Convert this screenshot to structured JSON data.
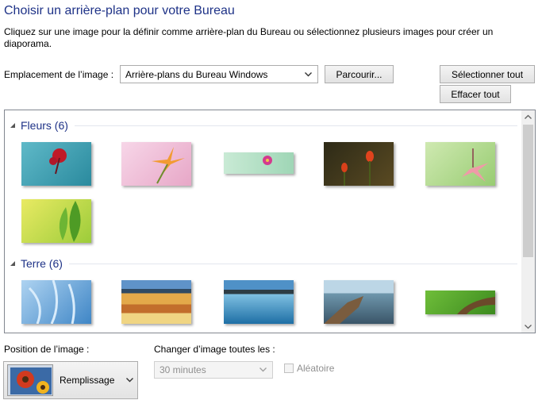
{
  "header": {
    "title": "Choisir un arrière-plan pour votre Bureau",
    "description": "Cliquez sur une image pour la définir comme arrière-plan du Bureau ou sélectionnez plusieurs images pour créer un diaporama."
  },
  "location": {
    "label": "Emplacement de l’image :",
    "value": "Arrière-plans du Bureau Windows",
    "browse_label": "Parcourir...",
    "select_all_label": "Sélectionner tout",
    "clear_all_label": "Effacer tout"
  },
  "gallery": {
    "groups": [
      {
        "title": "Fleurs (6)",
        "thumbs": [
          "flower-red-on-teal",
          "flower-orange-on-pink",
          "flower-pink-on-mint",
          "flower-orange-tulips-dark",
          "flower-pink-on-green",
          "green-leaf-on-yellow"
        ]
      },
      {
        "title": "Terre (6)",
        "thumbs": [
          "blue-ice",
          "striped-hills",
          "blue-seascape",
          "rocky-coast",
          "green-field-path"
        ]
      }
    ]
  },
  "position": {
    "label": "Position de l’image :",
    "value": "Remplissage"
  },
  "interval": {
    "label": "Changer d’image toutes les :",
    "value": "30 minutes"
  },
  "shuffle": {
    "label": "Aléatoire",
    "checked": false
  },
  "colors": {
    "title": "#1e3287",
    "group_title": "#1e3287",
    "disabled_text": "#8f8f8f"
  }
}
